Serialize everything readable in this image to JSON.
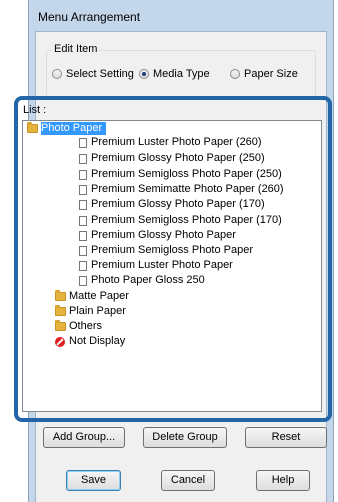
{
  "window": {
    "title": "Menu Arrangement"
  },
  "edit_item": {
    "legend": "Edit Item",
    "options": [
      {
        "label": "Select Setting",
        "checked": false
      },
      {
        "label": "Media Type",
        "checked": true
      },
      {
        "label": "Paper Size",
        "checked": false
      }
    ]
  },
  "list": {
    "label": "List :",
    "groups": [
      {
        "name": "Photo Paper",
        "selected": true,
        "items": [
          "Premium Luster Photo Paper (260)",
          "Premium Glossy Photo Paper (250)",
          "Premium Semigloss Photo Paper (250)",
          "Premium Semimatte Photo Paper (260)",
          "Premium Glossy Photo Paper (170)",
          "Premium Semigloss Photo Paper (170)",
          "Premium Glossy Photo Paper",
          "Premium Semigloss Photo Paper",
          "Premium Luster Photo Paper",
          "Photo Paper Gloss 250"
        ]
      },
      {
        "name": "Matte Paper",
        "items": []
      },
      {
        "name": "Plain Paper",
        "items": []
      },
      {
        "name": "Others",
        "items": []
      }
    ],
    "not_display": "Not Display"
  },
  "buttons": {
    "add_group": "Add Group...",
    "delete_group": "Delete Group",
    "reset": "Reset",
    "save": "Save",
    "cancel": "Cancel",
    "help": "Help"
  },
  "colors": {
    "highlight_frame": "#2266a8",
    "selection": "#3399ff",
    "window_frame": "#c4d6ea"
  }
}
